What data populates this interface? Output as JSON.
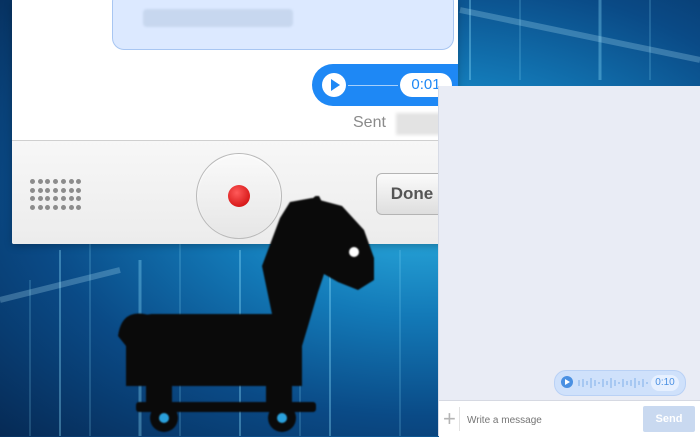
{
  "left_screen": {
    "audio_message": {
      "duration": "0:01"
    },
    "sent_label": "Sent",
    "toolbar": {
      "done_label": "Done"
    }
  },
  "right_screen": {
    "audio_message": {
      "duration": "0:10"
    },
    "composer": {
      "placeholder": "Write a message",
      "send_label": "Send",
      "plus_symbol": "+"
    }
  },
  "icons": [
    "keypad-icon",
    "record-icon",
    "play-icon",
    "trojan-horse-icon",
    "plus-icon"
  ],
  "colors": {
    "accent": "#1e88f5",
    "record": "#d60000",
    "background": "#137ab8"
  }
}
